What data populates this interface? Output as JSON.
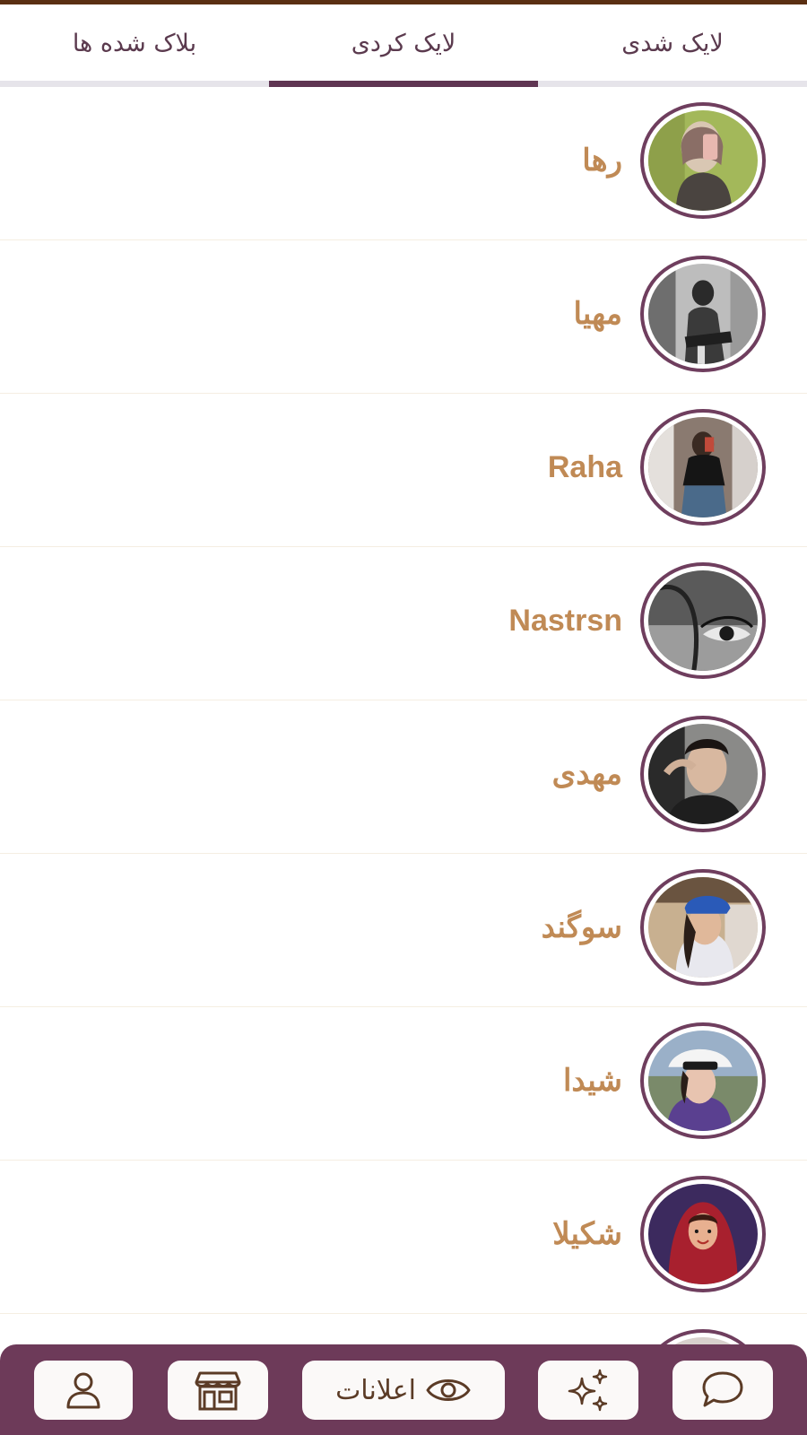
{
  "tabs": [
    {
      "label": "لایک شدی"
    },
    {
      "label": "لایک کردی",
      "active": true
    },
    {
      "label": "بلاک شده ها"
    }
  ],
  "users": [
    {
      "name": "رها",
      "avatar": "photo-girl-hijab-selfie"
    },
    {
      "name": "مهیا",
      "avatar": "photo-bw-selfie"
    },
    {
      "name": "Raha",
      "avatar": "photo-seated-selfie"
    },
    {
      "name": "Nastrsn",
      "avatar": "photo-bw-eye"
    },
    {
      "name": "مهدی",
      "avatar": "photo-man"
    },
    {
      "name": "سوگند",
      "avatar": "photo-bandana-girl"
    },
    {
      "name": "شیدا",
      "avatar": "photo-sunhat-girl"
    },
    {
      "name": "شکیلا",
      "avatar": "illustration-hijab-woman"
    }
  ],
  "bottom_nav": {
    "notifications_label": "اعلانات",
    "icons": [
      "chat-icon",
      "sparkles-icon",
      "eye-icon",
      "shop-icon",
      "profile-icon"
    ]
  },
  "colors": {
    "accent": "#6d3a59",
    "name_text": "#c08a55",
    "tab_text": "#5b3a4e",
    "nav_icon": "#5b3b26"
  }
}
